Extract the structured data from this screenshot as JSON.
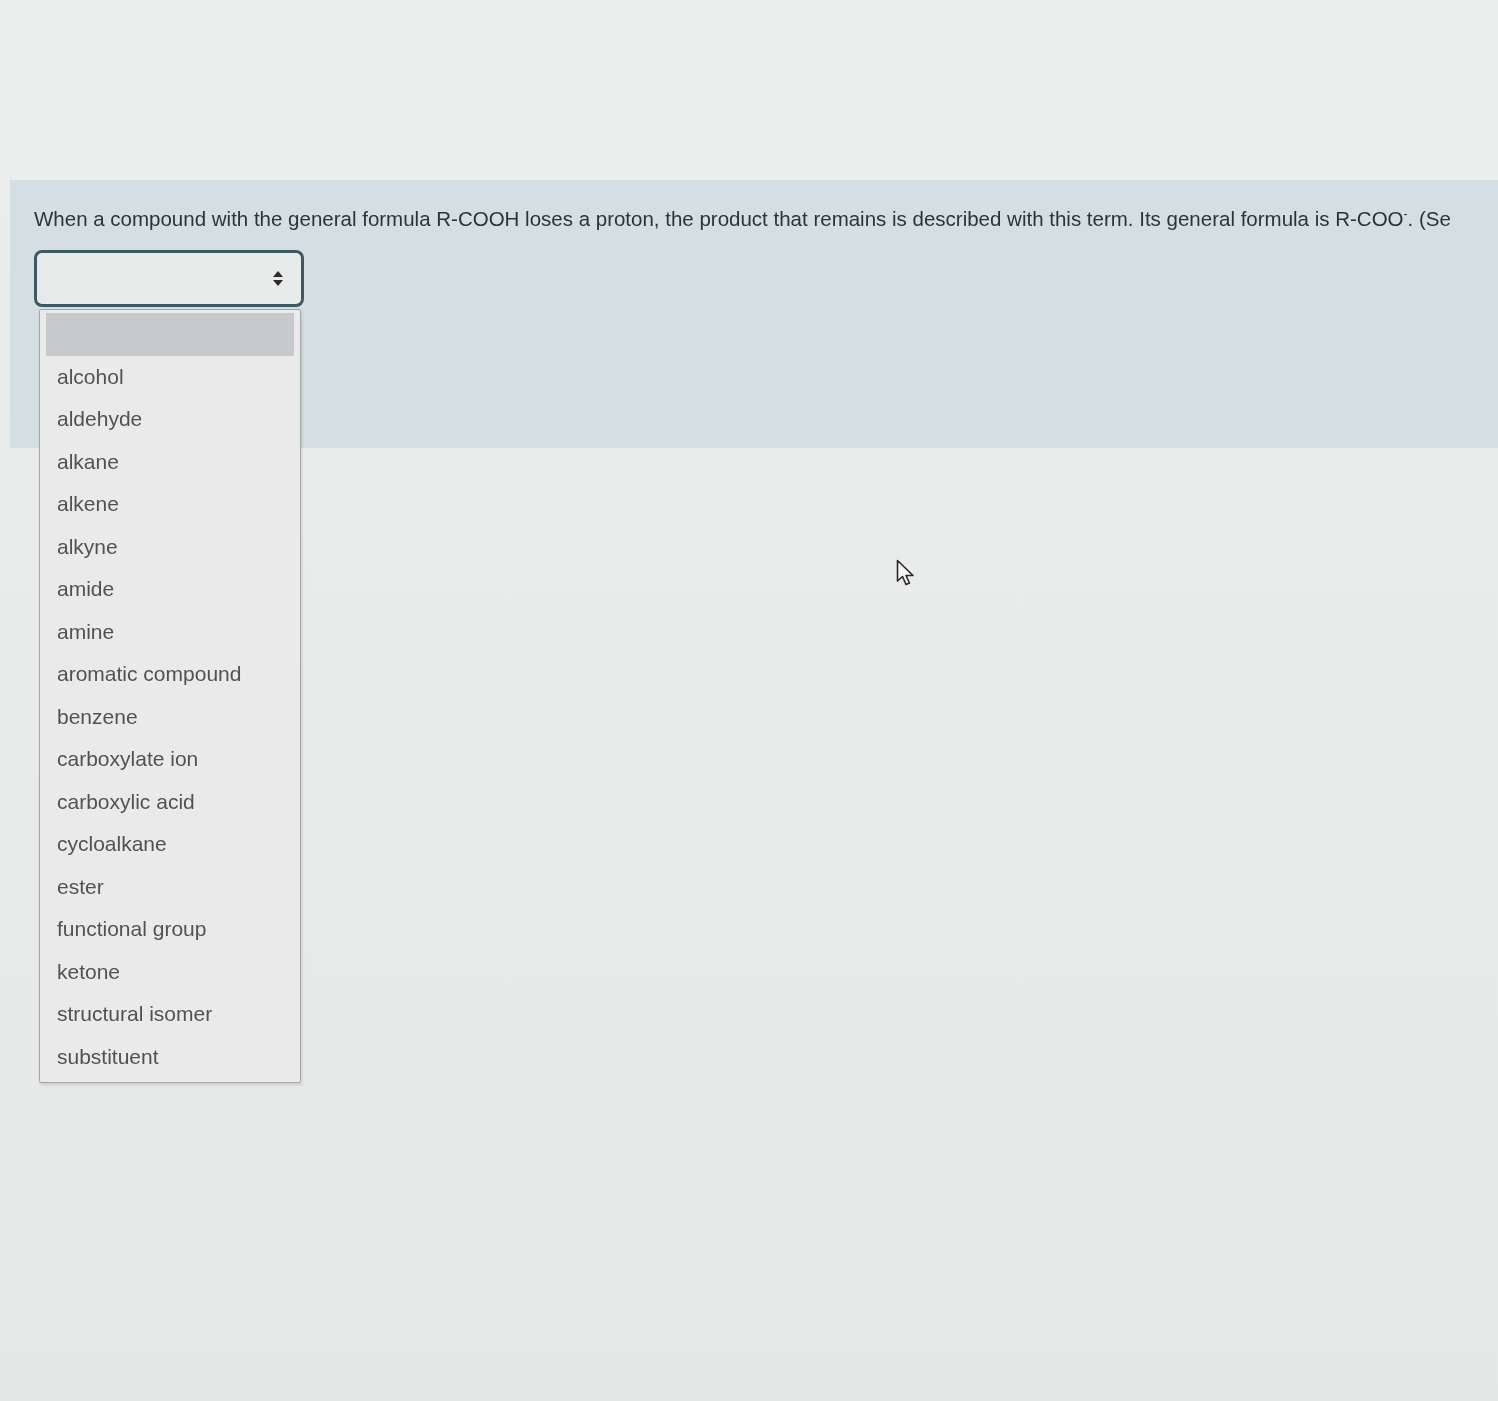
{
  "question": {
    "text": "When a compound with the general formula R-COOH loses a proton, the product that remains is described with this term. Its general formula is R-COO$^{-}$. (Se"
  },
  "answer_select": {
    "expanded": true,
    "options": [
      {
        "selected": true
      },
      {
        "label": "alcohol",
        "selected": false
      },
      {
        "label": "aldehyde",
        "selected": false
      },
      {
        "label": "alkane",
        "selected": false
      },
      {
        "label": "alkene",
        "selected": false
      },
      {
        "label": "alkyne",
        "selected": false
      },
      {
        "label": "amide",
        "selected": false
      },
      {
        "label": "amine",
        "selected": false
      },
      {
        "label": "aromatic compound",
        "selected": false
      },
      {
        "label": "benzene",
        "selected": false
      },
      {
        "label": "carboxylate ion",
        "selected": false
      },
      {
        "label": "carboxylic acid",
        "selected": false
      },
      {
        "label": "cycloalkane",
        "selected": false
      },
      {
        "label": "ester",
        "selected": false
      },
      {
        "label": "functional group",
        "selected": false
      },
      {
        "label": "ketone",
        "selected": false
      },
      {
        "label": "structural isomer",
        "selected": false
      },
      {
        "label": "substituent",
        "selected": false
      }
    ]
  }
}
